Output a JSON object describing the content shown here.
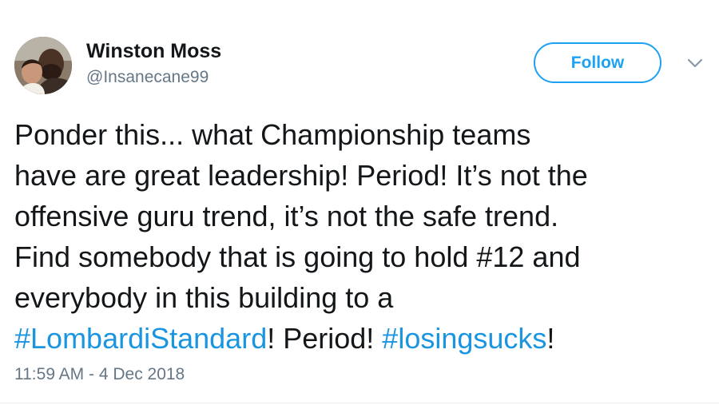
{
  "tweet": {
    "display_name": "Winston Moss",
    "handle": "@Insanecane99",
    "follow_label": "Follow",
    "text_lines": [
      "Ponder this... what Championship teams",
      "have are great leadership! Period! It’s not the",
      "offensive guru trend, it’s not the safe trend.",
      "Find somebody that is going to hold #12 and",
      "everybody in this building to a"
    ],
    "last_line": {
      "hashtag1": "#LombardiStandard",
      "mid": "! Period! ",
      "hashtag2": "#losingsucks",
      "end": "!"
    },
    "timestamp": "11:59 AM - 4 Dec 2018"
  },
  "icons": {
    "avatar": "profile-photo",
    "menu": "chevron-down-icon"
  },
  "colors": {
    "accent": "#1da1f2",
    "hashtag": "#1b95e0",
    "text": "#14171a",
    "secondary": "#657786"
  }
}
